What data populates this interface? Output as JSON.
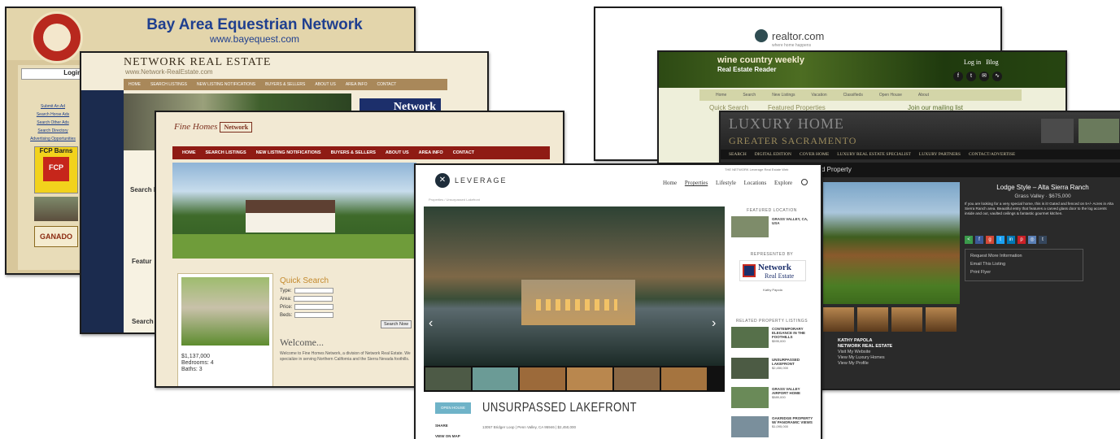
{
  "colors": {
    "bay_title": "#1f3f8f",
    "fine_nav": "#8f1b14",
    "network_navy": "#1c2f6b",
    "wine_green": "#2d4a14",
    "luxury_dark": "#2a2a2a",
    "leverage_badge": "#6fb3c8"
  },
  "bay": {
    "title": "Bay Area Equestrian Network",
    "url": "www.bayequest.com",
    "login_label": "Login",
    "sidebar_links": [
      "Submit An Ad",
      "Search Horse Ads",
      "Search Other Ads",
      "Search Directory",
      "Advertising Opportunities"
    ],
    "ad_fcp": "FCP Barns",
    "ad_ganado": "GANADO"
  },
  "network": {
    "brand": "NETWORK REAL ESTATE",
    "url": "www.Network-RealEstate.com",
    "nav": [
      "HOME",
      "SEARCH LISTINGS",
      "NEW LISTING NOTIFICATIONS",
      "BUYERS & SELLERS",
      "ABOUT US",
      "AREA INFO",
      "CONTACT"
    ],
    "logo": "Network",
    "search_heading": "Search L",
    "featured_heading": "Featur",
    "search2_heading": "Search S"
  },
  "fine": {
    "logo_text": "Fine Homes",
    "logo_badge": "Network",
    "nav": [
      "HOME",
      "SEARCH LISTINGS",
      "NEW LISTING NOTIFICATIONS",
      "BUYERS & SELLERS",
      "ABOUT US",
      "AREA INFO",
      "CONTACT"
    ],
    "listing_price": "$1,137,000",
    "listing_bedrooms": "Bedrooms: 4",
    "listing_baths": "Baths: 3",
    "quick_search_title": "Quick Search",
    "qs_fields": [
      "Type:",
      "Area:",
      "Price:",
      "Beds:"
    ],
    "search_button": "Search Now",
    "welcome": "Welcome...",
    "welcome_text": "Welcome to Fine Homes Network, a division of Network Real Estate. We specialize in serving Northern California and the Sierra Nevada foothills."
  },
  "realtor": {
    "logo": "realtor.com",
    "tagline": "where home happens"
  },
  "wine": {
    "title": "wine country weekly",
    "subtitle": "Real Estate Reader",
    "login": "Log in",
    "blog": "Blog",
    "nav": [
      "Home",
      "Search",
      "New Listings",
      "Vacation",
      "Classifieds",
      "Open House",
      "About"
    ],
    "quick_search": "Quick Search",
    "featured": "Featured Properties",
    "mailing": "Join our mailing list"
  },
  "luxury": {
    "title": "LUXURY HOME",
    "city": "GREATER SACRAMENTO",
    "menu": [
      "SEARCH",
      "DIGITAL EDITION",
      "COVER HOME",
      "LUXURY REAL ESTATE SPECIALIST",
      "LUXURY PARTNERS",
      "CONTACT/ADVERTISE"
    ],
    "property_label": "d Property",
    "listing_name": "Lodge Style – Alta Sierra Ranch",
    "listing_location": "Grass Valley · $675,000",
    "description": "If you are looking for a very special home, this is it! Gated and fenced on 5+/- Acres in Alta Sierra Ranch area. Beautiful entry that features a carved glass door to the log accents inside and out, vaulted ceilings & fantastic gourmet kitchen.",
    "actions": [
      "Request More Information",
      "Email This Listing",
      "Print Flyer"
    ],
    "agent_name": "KATHY PAPOLA",
    "agent_company": "NETWORK REAL ESTATE",
    "agent_lines": [
      "Visit My Website",
      "View My Luxury Homes",
      "View My Profile"
    ]
  },
  "leverage": {
    "logo": "LEVERAGE",
    "top_note": "THE NETWORK Leverage Real Estate Web",
    "nav": [
      "Home",
      "Properties",
      "Lifestyle",
      "Locations",
      "Explore"
    ],
    "breadcrumb": "Properties / Unsurpassed Lakefront",
    "side_featured": "FEATURED LOCATION",
    "side_featured_title": "GRASS VALLEY, CA, USA",
    "side_represented": "REPRESENTED BY",
    "net_logo_1": "Network",
    "net_logo_2": "Real Estate",
    "agent_name": "Kathy Papola",
    "side_related": "RELATED PROPERTY LISTINGS",
    "related": [
      {
        "title": "CONTEMPORARY ELEGANCE IN THE FOOTHILLS",
        "price": "$595,000"
      },
      {
        "title": "UNSURPASSED LAKEFRONT",
        "price": "$2,450,000"
      },
      {
        "title": "GRASS VALLEY AIRPORT HOME",
        "price": "$589,000"
      },
      {
        "title": "OAKRIDGE PROPERTY W/ PANORAMIC VIEWS",
        "price": "$1,095,000"
      }
    ],
    "open_label": "OPEN HOUSE",
    "title": "UNSURPASSED LAKEFRONT",
    "address": "13057 Bridger Loop  |  Penn Valley, CA 95946  |  $2,450,000",
    "labels": [
      "SHARE",
      "VIEW ON MAP"
    ]
  }
}
